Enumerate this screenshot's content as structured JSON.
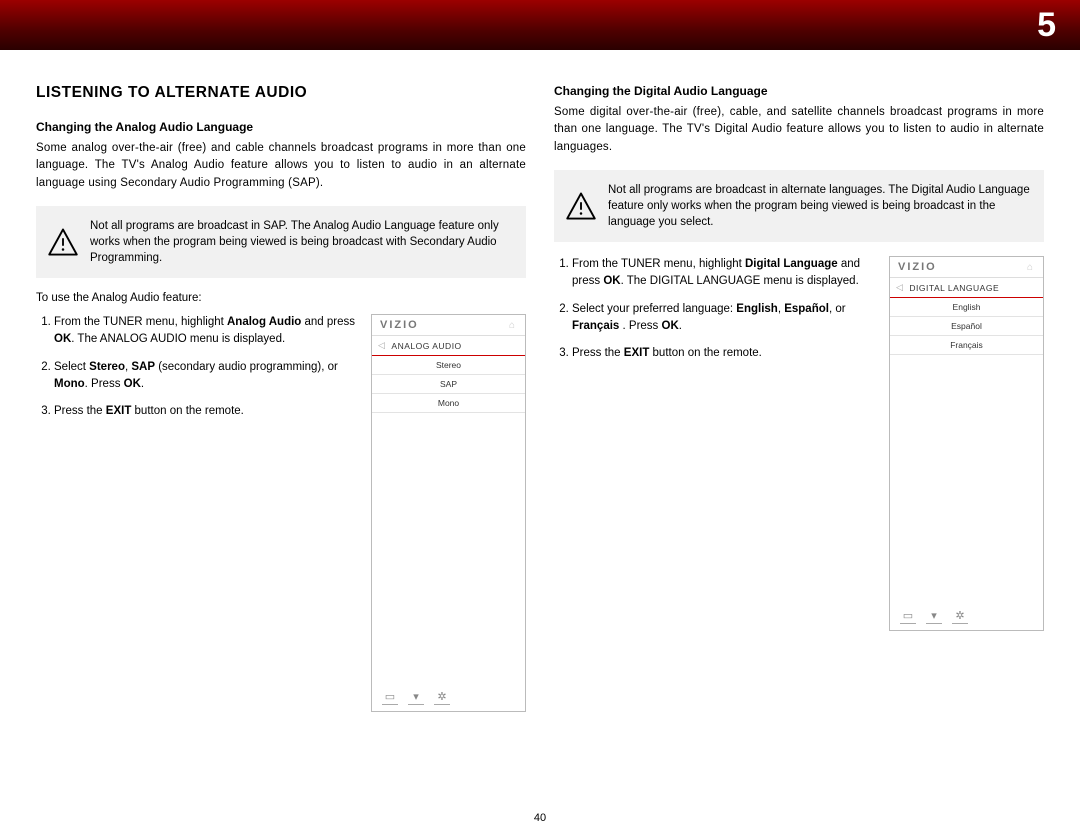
{
  "chapter_number": "5",
  "page_number": "40",
  "left": {
    "section_title": "LISTENING TO ALTERNATE AUDIO",
    "subheading": "Changing the Analog Audio Language",
    "body": "Some analog over-the-air (free) and cable channels broadcast programs in more than one language. The TV's Analog Audio feature allows you to listen to audio in an alternate language using Secondary Audio Programming (SAP).",
    "warning": "Not all programs are broadcast in SAP. The Analog Audio Language feature only works when the program being viewed is being broadcast with Secondary Audio Programming.",
    "intro": "To use the Analog Audio feature:",
    "steps": [
      "From the TUNER menu, highlight <b>Analog Audio</b> and press <b>OK</b>. The ANALOG AUDIO menu is displayed.",
      "Select <b>Stereo</b>, <b>SAP</b> (secondary audio programming), or <b>Mono</b>. Press <b>OK</b>.",
      "Press the <b>EXIT</b> button on the remote."
    ],
    "mock": {
      "brand": "VIZIO",
      "menu_title": "ANALOG AUDIO",
      "items": [
        "Stereo",
        "SAP",
        "Mono"
      ]
    }
  },
  "right": {
    "subheading": "Changing the Digital Audio Language",
    "body": "Some digital over-the-air (free), cable, and satellite channels broadcast programs in more than one language. The TV's Digital Audio feature allows you to listen to audio in alternate languages.",
    "warning": "Not all programs are broadcast in alternate languages. The Digital Audio Language feature only works when the program being viewed is being broadcast in the language you select.",
    "steps": [
      "From the TUNER menu, highlight <b>Digital Language</b> and press <b>OK</b>. The DIGITAL LANGUAGE menu is displayed.",
      "Select your preferred language: <b>English</b>, <b>Español</b>,  or <b>Français</b> . Press <b>OK</b>.",
      "Press the <b>EXIT</b> button on the remote."
    ],
    "mock": {
      "brand": "VIZIO",
      "menu_title": "DIGITAL LANGUAGE",
      "items": [
        "English",
        "Español",
        "Français"
      ]
    }
  }
}
